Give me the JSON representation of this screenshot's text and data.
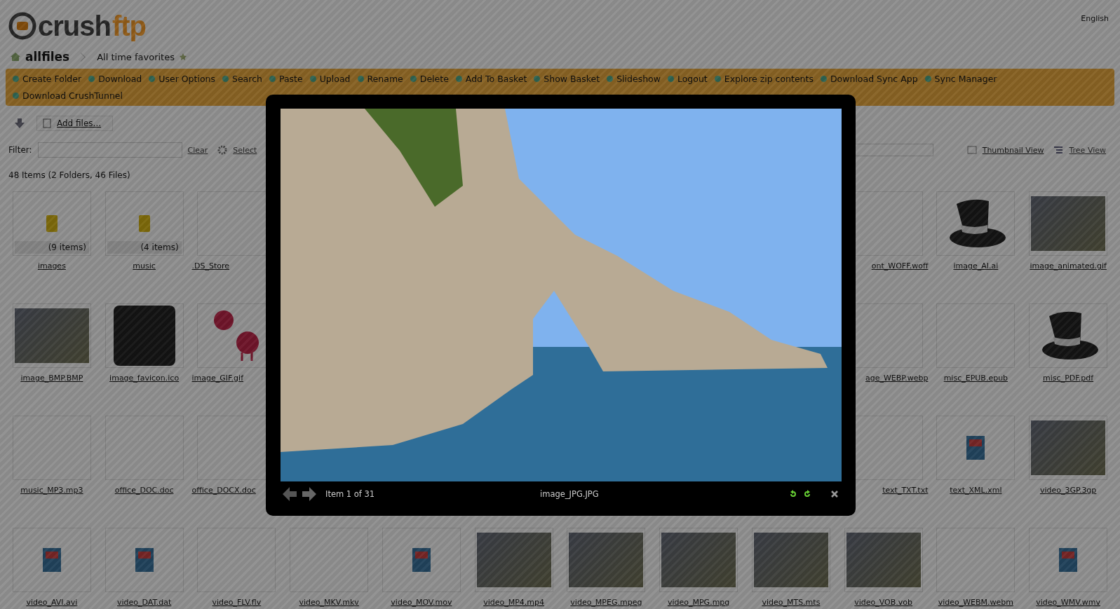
{
  "header": {
    "logo": {
      "part_1": "crush",
      "part_2": "ftp"
    },
    "language": "English"
  },
  "breadcrumb": {
    "current": "allfiles",
    "favorites": "All time favorites"
  },
  "toolbar": [
    "Create Folder",
    "Download",
    "User Options",
    "Search",
    "Paste",
    "Upload",
    "Rename",
    "Delete",
    "Add To Basket",
    "Show Basket",
    "Slideshow",
    "Logout",
    "Explore zip contents",
    "Download Sync App",
    "Sync Manager",
    "Download CrushTunnel"
  ],
  "upload": {
    "label": "Add files..."
  },
  "filter": {
    "label": "Filter:",
    "clear": "Clear",
    "select": "Select",
    "thumbnail_view": "Thumbnail View",
    "tree_view": "Tree View"
  },
  "summary": "48 Items (2 Folders, 46 Files)",
  "grid": [
    {
      "left": [
        {
          "name": "images",
          "kind": "folder",
          "count": "(9 items)"
        },
        {
          "name": "music",
          "kind": "folder",
          "count": "(4 items)"
        },
        {
          "name": ".DS_Store",
          "kind": "blank"
        }
      ],
      "right": [
        {
          "name": "ont_WOFF.woff",
          "kind": "blank"
        },
        {
          "name": "image_AI.ai",
          "kind": "hat"
        },
        {
          "name": "image_animated.gif",
          "kind": "photo"
        }
      ]
    },
    {
      "left": [
        {
          "name": "image_BMP.BMP",
          "kind": "photo"
        },
        {
          "name": "image_favicon.ico",
          "kind": "tile"
        },
        {
          "name": "image_GIF.gif",
          "kind": "monster"
        }
      ],
      "right": [
        {
          "name": "age_WEBP.webp",
          "kind": "blank"
        },
        {
          "name": "misc_EPUB.epub",
          "kind": "blank"
        },
        {
          "name": "misc_PDF.pdf",
          "kind": "hat"
        }
      ]
    },
    {
      "left": [
        {
          "name": "music_MP3.mp3",
          "kind": "blank"
        },
        {
          "name": "office_DOC.doc",
          "kind": "blank"
        },
        {
          "name": "office_DOCX.doc",
          "kind": "blank"
        }
      ],
      "right": [
        {
          "name": "text_TXT.txt",
          "kind": "blank"
        },
        {
          "name": "text_XML.xml",
          "kind": "file"
        },
        {
          "name": "video_3GP.3gp",
          "kind": "photo"
        }
      ]
    },
    {
      "left": [
        {
          "name": "video_AVI.avi",
          "kind": "file"
        },
        {
          "name": "video_DAT.dat",
          "kind": "file"
        },
        {
          "name": "video_FLV.flv",
          "kind": "blank"
        },
        {
          "name": "video_MKV.mkv",
          "kind": "blank"
        },
        {
          "name": "video_MOV.mov",
          "kind": "file"
        },
        {
          "name": "video_MP4.mp4",
          "kind": "photo"
        },
        {
          "name": "video_MPEG.mpeg",
          "kind": "photo"
        },
        {
          "name": "video_MPG.mpg",
          "kind": "photo"
        },
        {
          "name": "video_MTS.mts",
          "kind": "photo"
        },
        {
          "name": "video_VOB.vob",
          "kind": "photo"
        },
        {
          "name": "video_WEBM.webm",
          "kind": "blank"
        },
        {
          "name": "video_WMV.wmv",
          "kind": "file"
        }
      ]
    }
  ],
  "lightbox": {
    "counter": "Item 1 of 31",
    "file_name": "image_JPG.JPG"
  }
}
